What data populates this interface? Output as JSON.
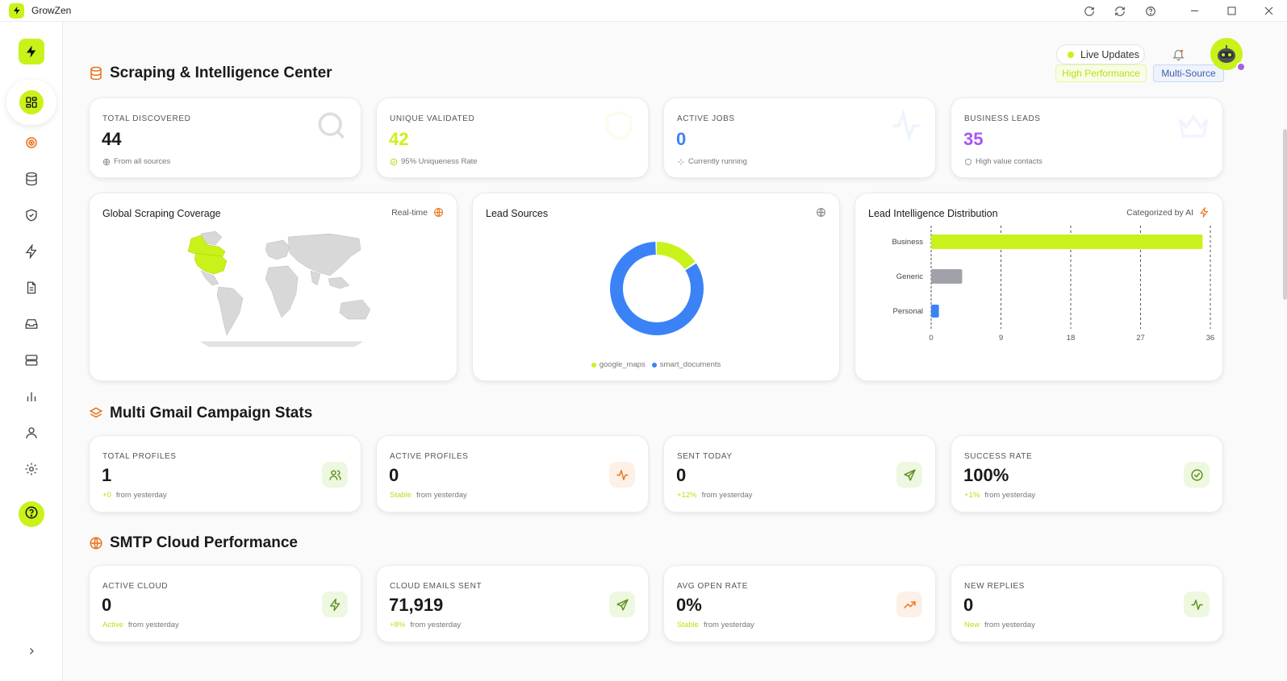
{
  "app": {
    "name": "GrowZen"
  },
  "header": {
    "live_updates": "Live Updates",
    "high_performance": "High Performance",
    "multi_source": "Multi-Source"
  },
  "sections": {
    "scraping": "Scraping & Intelligence Center",
    "gmail": "Multi Gmail Campaign Stats",
    "smtp": "SMTP Cloud Performance"
  },
  "scraping_stats": [
    {
      "label": "TOTAL DISCOVERED",
      "value": "44",
      "sub": "From all sources",
      "color": "#1a1a1a",
      "icon": "globe-icon",
      "bg_icon": "search-icon"
    },
    {
      "label": "UNIQUE VALIDATED",
      "value": "42",
      "sub": "95% Uniqueness Rate",
      "color": "#c9f21a",
      "icon": "check-circle-icon",
      "bg_icon": "shield-icon"
    },
    {
      "label": "ACTIVE JOBS",
      "value": "0",
      "sub": "Currently running",
      "color": "#3b82f6",
      "icon": "sparkle-icon",
      "bg_icon": "activity-icon"
    },
    {
      "label": "BUSINESS LEADS",
      "value": "35",
      "sub": "High value contacts",
      "color": "#a855f7",
      "icon": "shield-icon",
      "bg_icon": "crown-icon"
    }
  ],
  "charts": {
    "coverage": {
      "title": "Global Scraping Coverage",
      "tag": "Real-time"
    },
    "sources": {
      "title": "Lead Sources"
    },
    "distribution": {
      "title": "Lead Intelligence Distribution",
      "tag": "Categorized by AI"
    }
  },
  "chart_data": [
    {
      "type": "pie",
      "title": "Lead Sources",
      "categories": [
        "google_maps",
        "smart_documents"
      ],
      "values": [
        7,
        37
      ],
      "colors": [
        "#c9f21a",
        "#3b82f6"
      ],
      "legend": "bottom"
    },
    {
      "type": "bar",
      "orientation": "horizontal",
      "title": "Lead Intelligence Distribution",
      "categories": [
        "Business",
        "Generic",
        "Personal"
      ],
      "values": [
        35,
        4,
        1
      ],
      "colors": [
        "#c9f21a",
        "#a1a1aa",
        "#3b82f6"
      ],
      "xticks": [
        "0",
        "9",
        "18",
        "27",
        "36"
      ],
      "xlim": [
        0,
        36
      ],
      "grid": true
    }
  ],
  "gmail_stats": [
    {
      "label": "TOTAL PROFILES",
      "value": "1",
      "delta": "+0",
      "sub": "from yesterday",
      "icon": "users-icon",
      "tile": "#eef7e0",
      "ink": "#5a8f1a"
    },
    {
      "label": "ACTIVE PROFILES",
      "value": "0",
      "delta": "Stable",
      "sub": "from yesterday",
      "icon": "activity-icon",
      "tile": "#fdf0e6",
      "ink": "#e8701a"
    },
    {
      "label": "SENT TODAY",
      "value": "0",
      "delta": "+12%",
      "sub": "from yesterday",
      "icon": "send-icon",
      "tile": "#eef7e0",
      "ink": "#5a8f1a"
    },
    {
      "label": "SUCCESS RATE",
      "value": "100%",
      "delta": "+1%",
      "sub": "from yesterday",
      "icon": "check-circle-icon",
      "tile": "#eef7e0",
      "ink": "#5a8f1a"
    }
  ],
  "smtp_stats": [
    {
      "label": "ACTIVE CLOUD",
      "value": "0",
      "delta": "Active",
      "sub": "from yesterday",
      "icon": "lightning-icon",
      "tile": "#eef7e0",
      "ink": "#5a8f1a"
    },
    {
      "label": "CLOUD EMAILS SENT",
      "value": "71,919",
      "delta": "+8%",
      "sub": "from yesterday",
      "icon": "send-icon",
      "tile": "#eef7e0",
      "ink": "#5a8f1a"
    },
    {
      "label": "AVG OPEN RATE",
      "value": "0%",
      "delta": "Stable",
      "sub": "from yesterday",
      "icon": "trending-up-icon",
      "tile": "#fdf0e6",
      "ink": "#e8701a"
    },
    {
      "label": "NEW REPLIES",
      "value": "0",
      "delta": "New",
      "sub": "from yesterday",
      "icon": "activity-icon",
      "tile": "#eef7e0",
      "ink": "#5a8f1a"
    }
  ],
  "colors": {
    "accent": "#c9f21a",
    "orange": "#e8701a",
    "blue": "#3b82f6",
    "purple": "#a855f7"
  }
}
